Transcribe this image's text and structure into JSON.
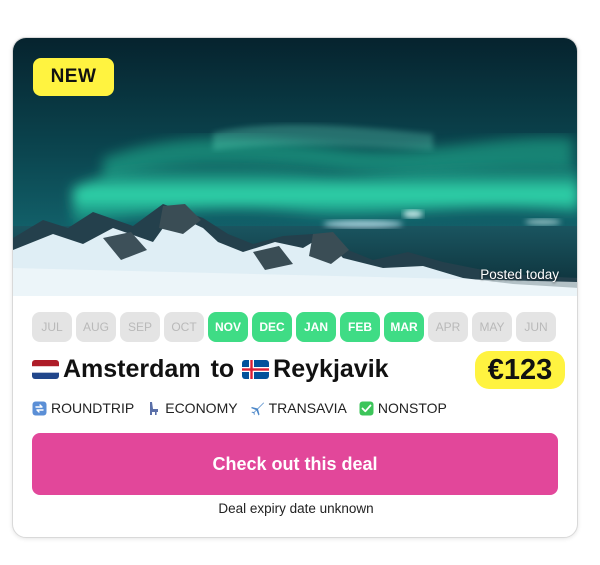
{
  "badge": "NEW",
  "posted": "Posted today",
  "months": [
    {
      "label": "JUL",
      "active": false
    },
    {
      "label": "AUG",
      "active": false
    },
    {
      "label": "SEP",
      "active": false
    },
    {
      "label": "OCT",
      "active": false
    },
    {
      "label": "NOV",
      "active": true
    },
    {
      "label": "DEC",
      "active": true
    },
    {
      "label": "JAN",
      "active": true
    },
    {
      "label": "FEB",
      "active": true
    },
    {
      "label": "MAR",
      "active": true
    },
    {
      "label": "APR",
      "active": false
    },
    {
      "label": "MAY",
      "active": false
    },
    {
      "label": "JUN",
      "active": false
    }
  ],
  "route": {
    "origin": "Amsterdam",
    "connector": "to",
    "destination": "Reykjavik",
    "origin_flag": "netherlands-flag-icon",
    "destination_flag": "iceland-flag-icon"
  },
  "price": "€123",
  "tags": [
    {
      "icon": "repeat-icon",
      "label": "ROUNDTRIP"
    },
    {
      "icon": "seat-icon",
      "label": "ECONOMY"
    },
    {
      "icon": "airplane-icon",
      "label": "TRANSAVIA"
    },
    {
      "icon": "check-icon",
      "label": "NONSTOP"
    }
  ],
  "cta": "Check out this deal",
  "expiry": "Deal expiry date unknown",
  "colors": {
    "badge": "#fff340",
    "month_active": "#3fdc85",
    "month_inactive": "#e4e4e4",
    "cta": "#e2479a"
  }
}
